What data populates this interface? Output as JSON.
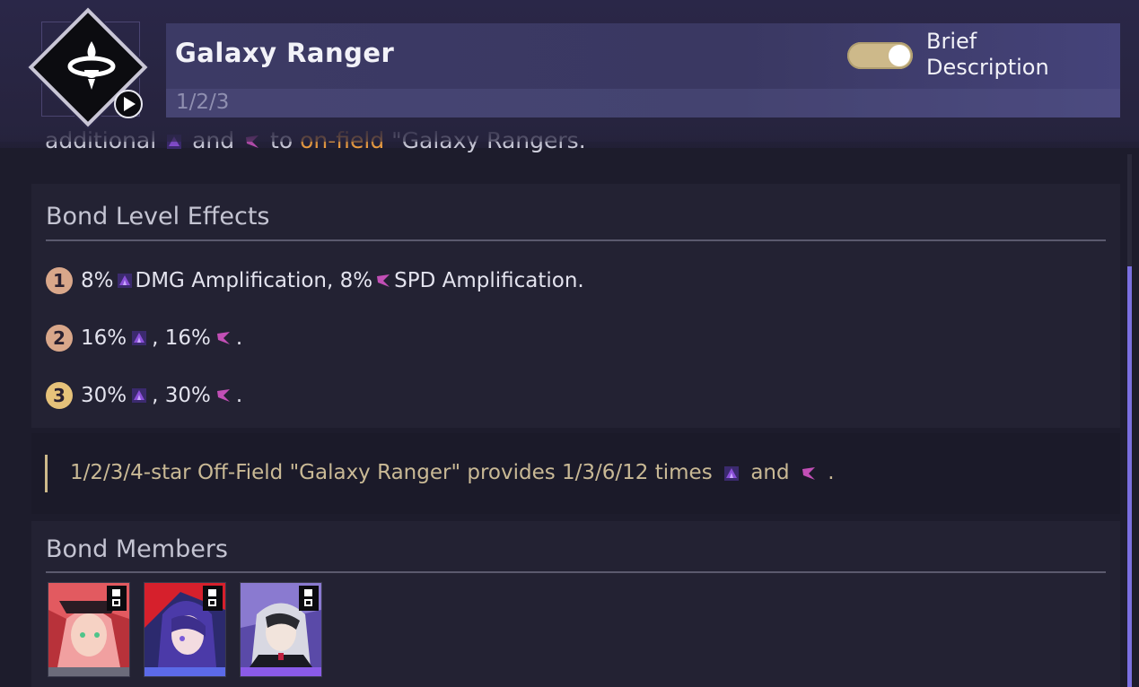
{
  "header": {
    "title": "Galaxy Ranger",
    "levels": "1/2/3",
    "toggle_label": "Brief Description",
    "toggle_on": true
  },
  "clipped_text": {
    "part1": "additional",
    "part2": "and",
    "part3": "to",
    "highlight": "on-field",
    "part4": "\"Galaxy Rangers."
  },
  "bond_effects": {
    "title": "Bond Level Effects",
    "rows": [
      {
        "level": "1",
        "color": "#d9a78a",
        "text_a": "8%",
        "text_b": "DMG Amplification, 8%",
        "text_c": "SPD Amplification."
      },
      {
        "level": "2",
        "color": "#d9a78a",
        "text_a": "16%",
        "text_b": ", 16%",
        "text_c": "."
      },
      {
        "level": "3",
        "color": "#e6c27a",
        "text_a": "30%",
        "text_b": ", 30%",
        "text_c": "."
      }
    ]
  },
  "note": {
    "text_a": "1/2/3/4-star Off-Field \"Galaxy Ranger\" provides 1/3/6/12 times",
    "text_b": "and",
    "text_c": "."
  },
  "bond_members": {
    "title": "Bond Members",
    "members": [
      {
        "stripe_color": "#6b6b7a"
      },
      {
        "stripe_color": "#5b6ae8"
      },
      {
        "stripe_color": "#8a5be8"
      }
    ]
  },
  "icons": {
    "dmg": "dmg-amplification-icon",
    "spd": "spd-amplification-icon"
  },
  "colors": {
    "accent": "#cdb98a",
    "highlight": "#f0a040",
    "icon_purple": "#8a4fd8",
    "icon_pink": "#c24fb6"
  }
}
